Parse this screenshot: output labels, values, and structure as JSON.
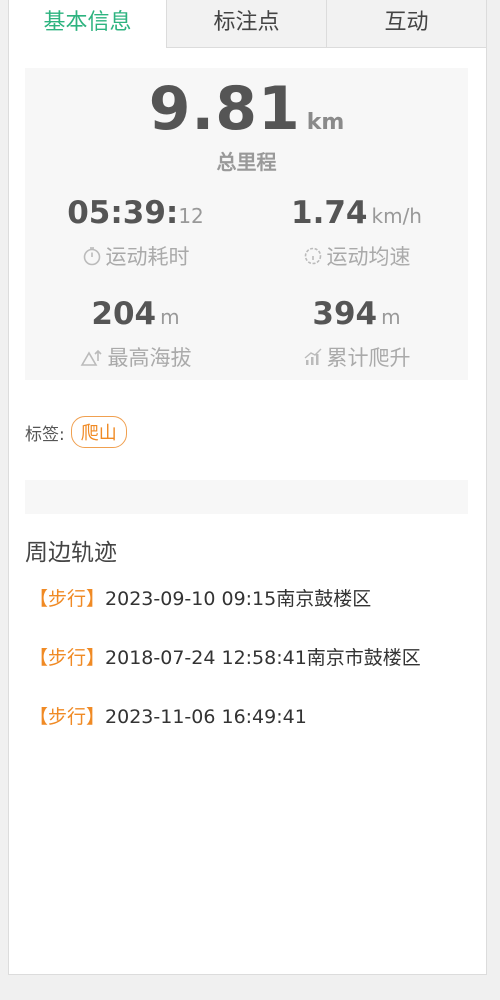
{
  "tabs": [
    {
      "label": "基本信息",
      "active": true
    },
    {
      "label": "标注点",
      "active": false
    },
    {
      "label": "互动",
      "active": false
    }
  ],
  "summary": {
    "distance": "9.81",
    "distance_unit": "km",
    "distance_label": "总里程",
    "duration_main": "05:39:",
    "duration_sec": "12",
    "duration_label": "运动耗时",
    "speed": "1.74",
    "speed_unit": "km/h",
    "speed_label": "运动均速",
    "altitude": "204",
    "altitude_unit": "m",
    "altitude_label": "最高海拔",
    "climb": "394",
    "climb_unit": "m",
    "climb_label": "累计爬升"
  },
  "tags": {
    "label": "标签:",
    "items": [
      "爬山"
    ]
  },
  "nearby": {
    "title": "周边轨迹",
    "items": [
      {
        "type": "【步行】",
        "text": "2023-09-10 09:15南京鼓楼区"
      },
      {
        "type": "【步行】",
        "text": "2018-07-24 12:58:41南京市鼓楼区"
      },
      {
        "type": "【步行】",
        "text": "2023-11-06 16:49:41"
      }
    ]
  },
  "colors": {
    "accent": "#2db37f",
    "tag": "#f08a24"
  }
}
